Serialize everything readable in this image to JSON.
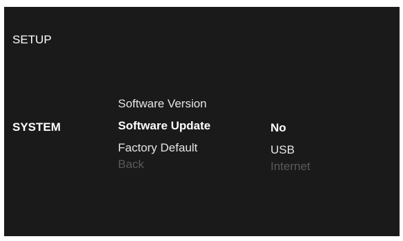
{
  "screen": {
    "title": "SETUP",
    "category": "SYSTEM"
  },
  "menu": {
    "items": [
      {
        "label": "Software Version",
        "state": "normal"
      },
      {
        "label": "Software Update",
        "state": "selected"
      },
      {
        "label": "Factory Default",
        "state": "normal"
      },
      {
        "label": "Back",
        "state": "disabled"
      }
    ]
  },
  "options": {
    "items": [
      {
        "label": "No",
        "state": "selected"
      },
      {
        "label": "USB",
        "state": "normal"
      },
      {
        "label": "Internet",
        "state": "disabled"
      }
    ]
  },
  "colors": {
    "background": "#1a1a1a",
    "text_normal": "#e6e6e6",
    "text_selected": "#ffffff",
    "text_disabled": "#5a5a5a"
  }
}
